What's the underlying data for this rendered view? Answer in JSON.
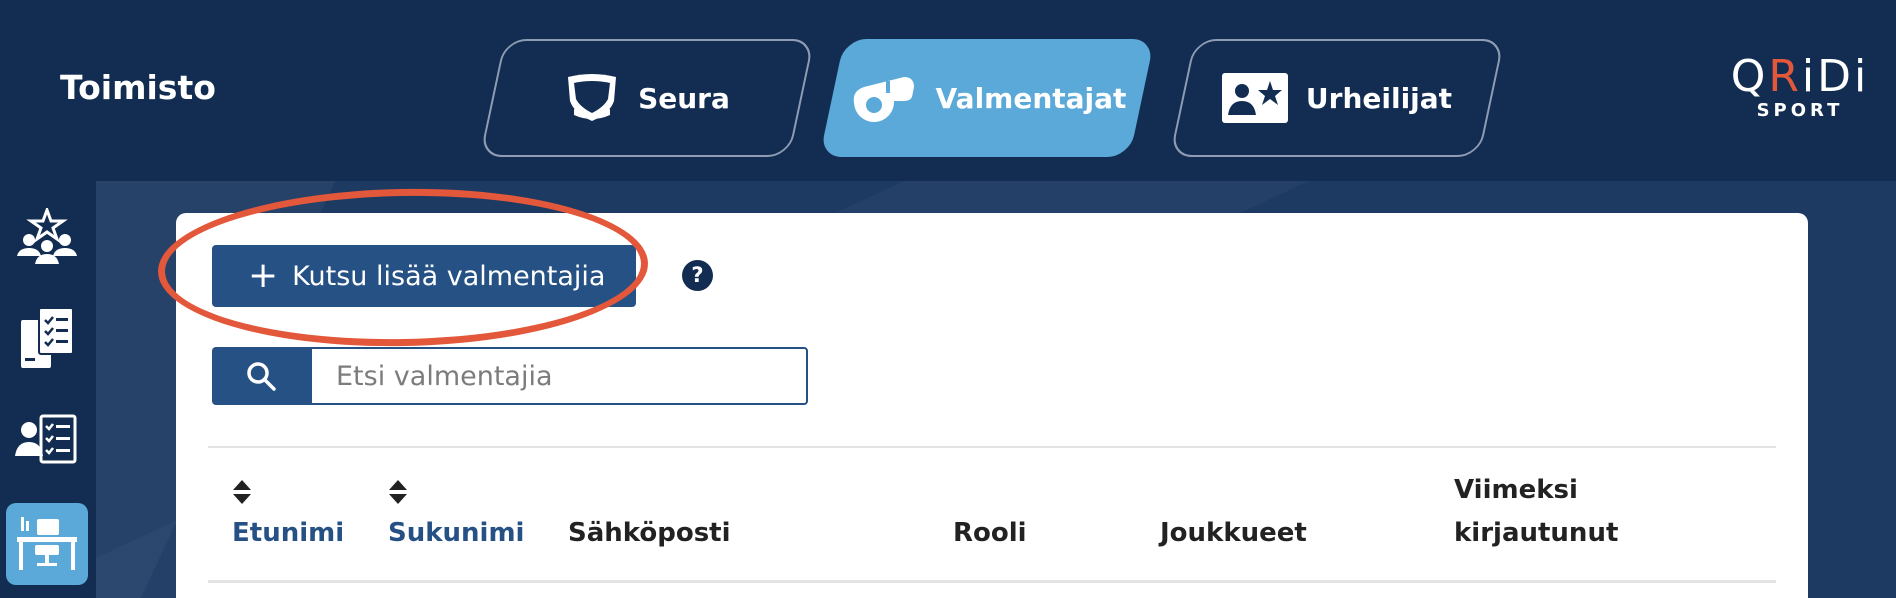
{
  "header": {
    "title": "Toimisto",
    "tabs": [
      {
        "label": "Seura",
        "icon": "shield-icon",
        "active": false
      },
      {
        "label": "Valmentajat",
        "icon": "whistle-icon",
        "active": true
      },
      {
        "label": "Urheilijat",
        "icon": "athlete-card-icon",
        "active": false
      }
    ],
    "logo": {
      "main_1": "Q",
      "main_2": "R",
      "main_3": "i",
      "main_4": "D",
      "main_5": "i",
      "sub": "SPORT"
    }
  },
  "sidebar": {
    "items": [
      {
        "icon": "team-star-icon",
        "active": false
      },
      {
        "icon": "documents-checklist-icon",
        "active": false
      },
      {
        "icon": "person-checklist-icon",
        "active": false
      },
      {
        "icon": "desk-icon",
        "active": true
      }
    ]
  },
  "main": {
    "invite_button": "Kutsu lisää valmentajia",
    "help": "?",
    "search": {
      "placeholder": "Etsi valmentajia",
      "value": ""
    },
    "table": {
      "columns": [
        {
          "label": "Etunimi",
          "sortable": true
        },
        {
          "label": "Sukunimi",
          "sortable": true
        },
        {
          "label": "Sähköposti",
          "sortable": false
        },
        {
          "label": "Rooli",
          "sortable": false
        },
        {
          "label": "Joukkueet",
          "sortable": false
        },
        {
          "label_line1": "Viimeksi",
          "label_line2": "kirjautunut",
          "sortable": false
        }
      ]
    }
  },
  "colors": {
    "header_bg": "#132d52",
    "page_bg": "#1d3a63",
    "active_tab": "#5aa9d8",
    "primary_button": "#255184",
    "highlight_ring": "#e3573a",
    "sortable_header": "#255184"
  }
}
